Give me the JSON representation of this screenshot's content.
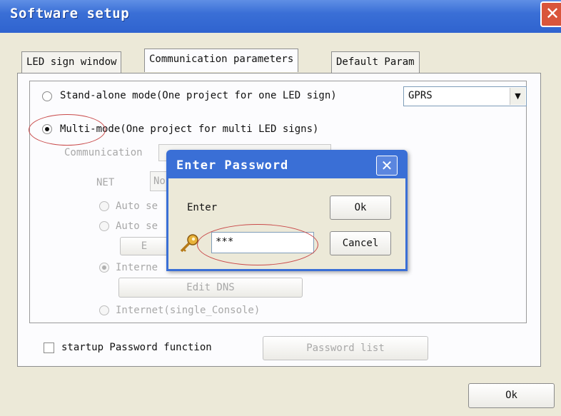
{
  "window": {
    "title": "Software setup",
    "close_glyph": "✕"
  },
  "tabs": [
    {
      "label": "LED sign window"
    },
    {
      "label": "Communication parameters"
    },
    {
      "label": "Default Param"
    }
  ],
  "mode": {
    "standalone_label": "Stand-alone mode(One project for one LED sign)",
    "protocol_value": "GPRS",
    "multi_label": "Multi-mode(One project for multi LED signs)"
  },
  "comm": {
    "communication_label": "Communication",
    "net_label": "NET",
    "net_value": "No",
    "auto_1": "Auto se",
    "auto_2": "Auto se",
    "button_partial": "E",
    "internet_1": "Interne",
    "edit_dns": "Edit DNS",
    "internet_single": "Internet(single_Console)"
  },
  "footer": {
    "startup_password": "startup Password function",
    "password_list": "Password list",
    "ok": "Ok"
  },
  "dialog": {
    "title": "Enter Password",
    "close_glyph": "✕",
    "enter_label": "Enter",
    "ok": "Ok",
    "cancel": "Cancel",
    "password_value": "***"
  },
  "colors": {
    "titlebar": "#3a6fd6",
    "annotation": "#c94a4a",
    "close": "#d9553b"
  },
  "icons": {
    "key": "key-icon",
    "dropdown": "chevron-down-icon"
  }
}
